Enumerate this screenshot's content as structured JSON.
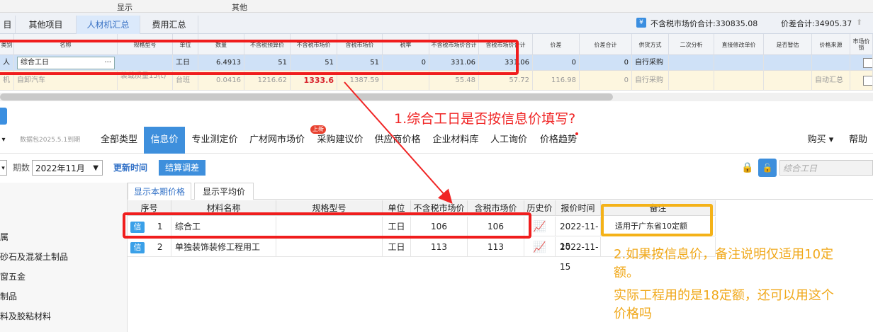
{
  "topstrip": {
    "display": "显示",
    "other": "其他"
  },
  "tabs": [
    {
      "label": "目"
    },
    {
      "label": "其他项目"
    },
    {
      "label": "人材机汇总",
      "active": true
    },
    {
      "label": "费用汇总"
    }
  ],
  "summary": {
    "market_total": "不含税市场价合计:330835.08",
    "diff_total": "价差合计:34905.37"
  },
  "grid": {
    "headers": [
      "类别",
      "名称",
      "规格型号",
      "单位",
      "数量",
      "不含税预算价",
      "不含税市场价",
      "含税市场价",
      "税率",
      "不含税市场价合计",
      "含税市场价合计",
      "价差",
      "价差合计",
      "供货方式",
      "二次分析",
      "直接修改单价",
      "是否暂估",
      "价格来源",
      "市场价锁"
    ],
    "rows": [
      {
        "type": "人",
        "name": "综合工日",
        "spec": "",
        "unit": "工日",
        "qty": "6.4913",
        "budget": "51",
        "market": "51",
        "market_tax": "51",
        "tax": "0",
        "market_sum": "331.06",
        "market_tax_sum": "331.06",
        "diff": "0",
        "diff_sum": "0",
        "supply": "自行采购",
        "second": "",
        "direct": "",
        "temp": "",
        "source": ""
      },
      {
        "type": "机",
        "name": "自卸汽车",
        "spec": "装载质量15(t)",
        "unit": "台班",
        "qty": "0.0416",
        "budget": "1216.62",
        "market": "1333.6",
        "market_tax": "1387.59",
        "tax": "",
        "market_sum": "55.48",
        "market_tax_sum": "57.72",
        "diff": "116.98",
        "diff_sum": "0",
        "supply": "自行采购",
        "second": "",
        "direct": "",
        "temp": "",
        "source": "自动汇总"
      }
    ]
  },
  "nav": {
    "package": "数据包2025.5.1到期",
    "items": [
      "全部类型",
      "信息价",
      "专业测定价",
      "广材网市场价",
      "采购建议价",
      "供应商价格",
      "企业材料库",
      "人工询价",
      "价格趋势"
    ],
    "badge": "上新",
    "buy": "购买",
    "help": "帮助"
  },
  "filter": {
    "period_label": "期数",
    "period_value": "2022年11月",
    "update_time": "更新时间",
    "settle": "结算调差",
    "search_placeholder": "综合工日"
  },
  "subtabs": [
    "显示本期价格",
    "显示平均价"
  ],
  "categories": [
    "属",
    "砂石及混凝土制品",
    "窗五金",
    "制品",
    "料及胶粘材料"
  ],
  "subgrid": {
    "headers": [
      "序号",
      "材料名称",
      "规格型号",
      "单位",
      "不含税市场价",
      "含税市场价",
      "历史价",
      "报价时间",
      "备注"
    ],
    "rows": [
      {
        "tag": "信",
        "no": "1",
        "name": "综合工",
        "spec": "",
        "unit": "工日",
        "price": "106",
        "price_tax": "106",
        "time": "2022-11-15",
        "note": "适用于广东省10定额"
      },
      {
        "tag": "信",
        "no": "2",
        "name": "单独装饰装修工程用工",
        "spec": "",
        "unit": "工日",
        "price": "113",
        "price_tax": "113",
        "time": "2022-11-15",
        "note": ""
      }
    ]
  },
  "annotations": {
    "q1": "1.综合工日是否按信息价填写?",
    "q2_line1": "2.如果按信息价，备注说明仅适用10定",
    "q2_line2": "额。",
    "q2_line3": "实际工程用的是18定额，还可以用这个",
    "q2_line4": "价格吗"
  }
}
